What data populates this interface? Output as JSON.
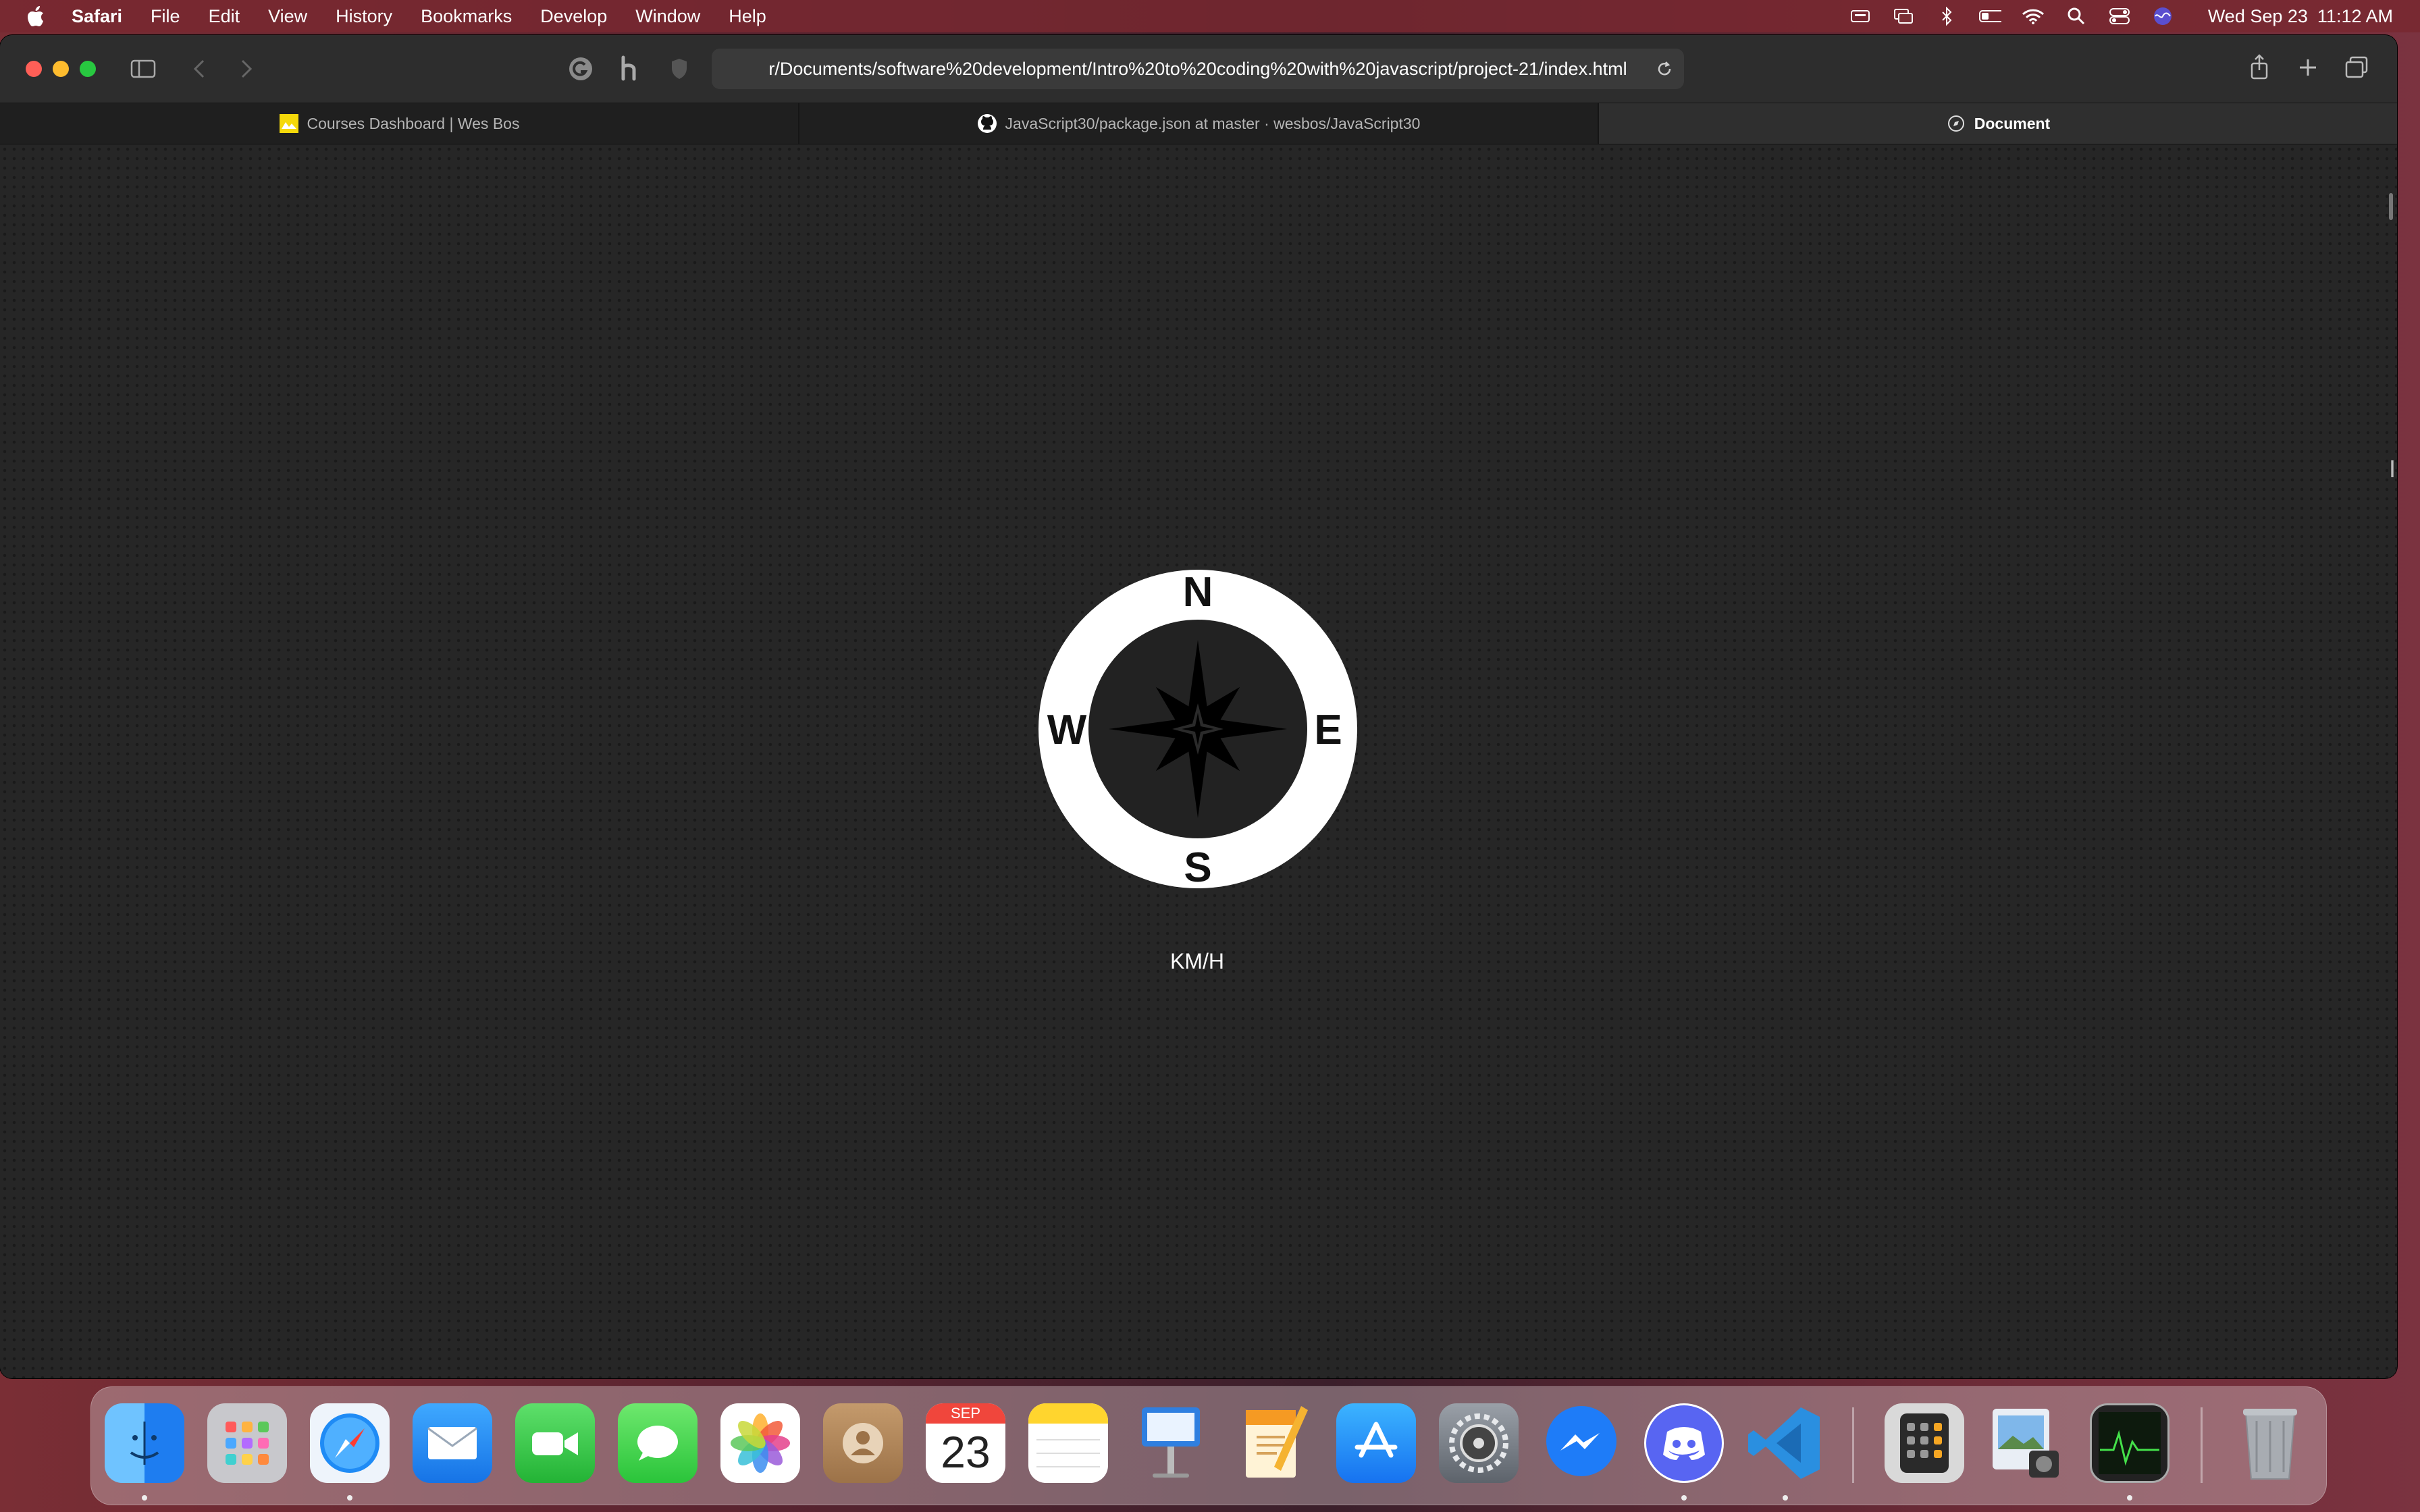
{
  "menubar": {
    "app_name": "Safari",
    "menus": [
      "File",
      "Edit",
      "View",
      "History",
      "Bookmarks",
      "Develop",
      "Window",
      "Help"
    ],
    "date": "Wed Sep 23",
    "time": "11:12 AM"
  },
  "toolbar": {
    "url": "r/Documents/software%20development/Intro%20to%20coding%20with%20javascript/project-21/index.html"
  },
  "tabs": [
    {
      "title": "Courses Dashboard | Wes Bos",
      "icon": "wes-bos-favicon-icon",
      "active": false
    },
    {
      "title": "JavaScript30/package.json at master · wesbos/JavaScript30",
      "icon": "github-icon",
      "active": false
    },
    {
      "title": "Document",
      "icon": "compass-favicon-icon",
      "active": true
    }
  ],
  "page": {
    "compass": {
      "north": "N",
      "east": "E",
      "south": "S",
      "west": "W"
    },
    "speed_unit": "KM/H"
  },
  "dock": {
    "calendar": {
      "month": "SEP",
      "day": "23"
    },
    "apps": [
      "Finder",
      "Launchpad",
      "Safari",
      "Mail",
      "FaceTime",
      "Messages",
      "Photos",
      "Contacts",
      "Calendar",
      "Notes",
      "Keynote",
      "Pages",
      "App Store",
      "System Preferences",
      "Messenger",
      "Discord",
      "Visual Studio Code",
      "Calculator",
      "Preview",
      "Activity Monitor",
      "Trash"
    ]
  },
  "colors": {
    "page_bg": "#262626",
    "tab_active": "#2f2f2f",
    "traffic_red": "#ff5f57",
    "traffic_yellow": "#febc2e",
    "traffic_green": "#28c840"
  }
}
